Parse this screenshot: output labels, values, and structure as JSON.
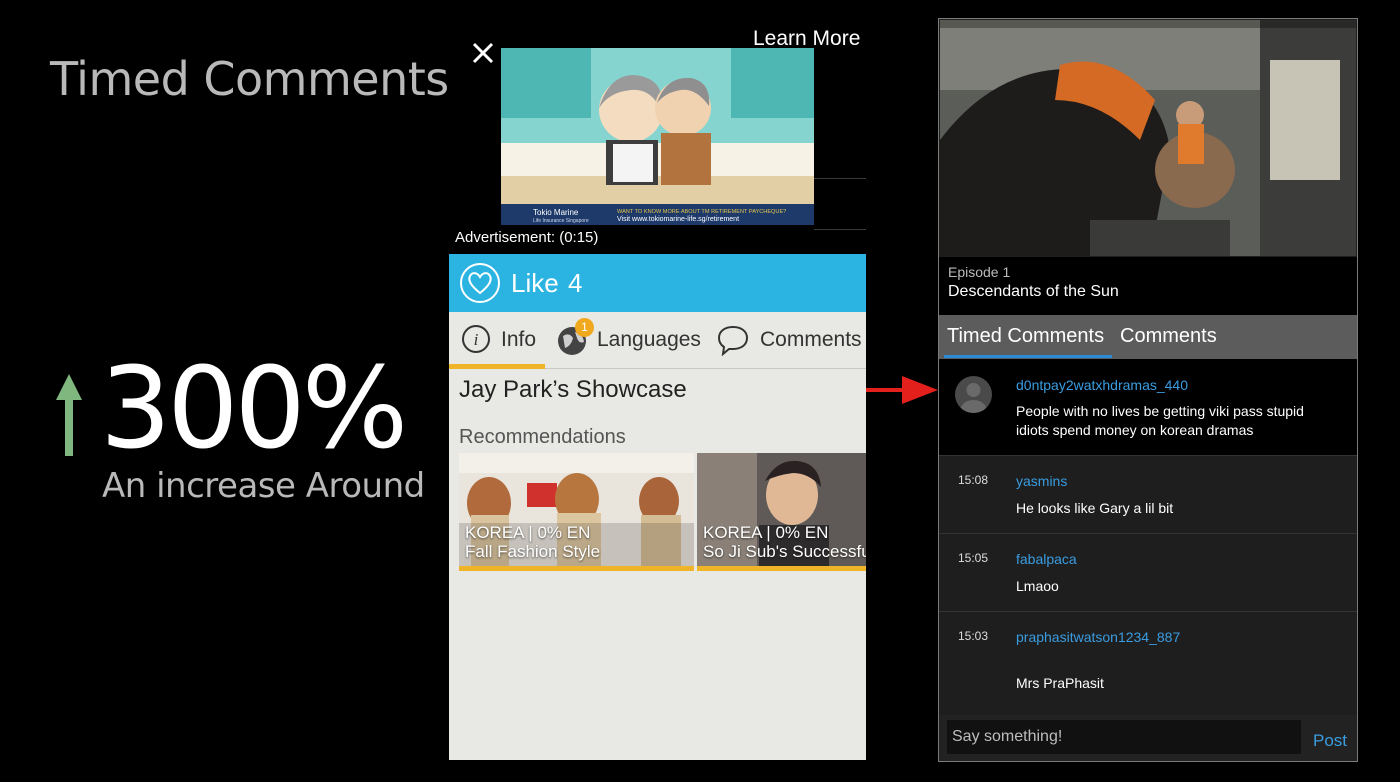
{
  "promo": {
    "title": "Timed Comments",
    "stat": "300%",
    "caption": "An increase Around",
    "arrow_color": "#7fb77e"
  },
  "ad": {
    "learn_more": "Learn More",
    "timer": "Advertisement: (0:15)",
    "brand": "Tokio Marine",
    "brand_sub": "Life Insurance Singapore",
    "banner_line1": "WANT TO KNOW MORE ABOUT TM RETIREMENT PAYCHEQUE?",
    "banner_line2": "Visit www.tokiomarine-life.sg/retirement"
  },
  "app": {
    "like_label": "Like",
    "like_count": "4",
    "tabs": [
      {
        "label": "Info",
        "icon": "info-icon",
        "active": true
      },
      {
        "label": "Languages",
        "icon": "globe-icon",
        "badge": "1"
      },
      {
        "label": "Comments",
        "icon": "speech-bubble-icon"
      }
    ],
    "show_title": "Jay Park’s Showcase",
    "recommendations_heading": "Recommendations",
    "recommendations": [
      {
        "meta": "KOREA | 0% EN",
        "title": "Fall Fashion Style"
      },
      {
        "meta": "KOREA | 0% EN",
        "title": "So Ji Sub's Successful"
      }
    ],
    "accent": "#2bb3e1",
    "highlight": "#f0b429"
  },
  "player": {
    "episode": "Episode 1",
    "title": "Descendants of the Sun",
    "tabs": [
      {
        "label": "Timed Comments",
        "active": true
      },
      {
        "label": "Comments"
      }
    ],
    "comments": [
      {
        "time": "",
        "user": "d0ntpay2watxhdramas_440",
        "text": "People with no lives be getting viki pass stupid idiots spend money on korean dramas",
        "highlight": true
      },
      {
        "time": "15:08",
        "user": "yasmins",
        "text": "He looks like Gary a lil bit"
      },
      {
        "time": "15:05",
        "user": "fabalpaca",
        "text": "Lmaoo"
      },
      {
        "time": "15:03",
        "user": "praphasitwatson1234_887",
        "text": "Mrs PraPhasit"
      }
    ],
    "input_placeholder": "Say something!",
    "post_label": "Post",
    "link_color": "#3a9ce0"
  }
}
